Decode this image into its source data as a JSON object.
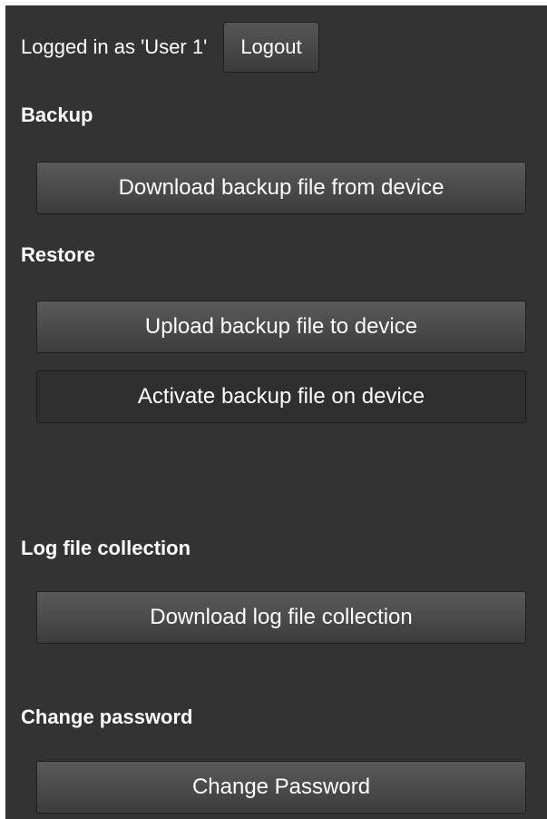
{
  "header": {
    "login_text": "Logged in as 'User 1'",
    "logout_label": "Logout"
  },
  "sections": {
    "backup": {
      "title": "Backup",
      "download_label": "Download backup file from device"
    },
    "restore": {
      "title": "Restore",
      "upload_label": "Upload backup file to device",
      "activate_label": "Activate backup file on device"
    },
    "log": {
      "title": "Log file collection",
      "download_label": "Download log file collection"
    },
    "password": {
      "title": "Change password",
      "button_label": "Change Password"
    }
  },
  "colors": {
    "panel_background": "#333333",
    "text": "#ffffff"
  }
}
